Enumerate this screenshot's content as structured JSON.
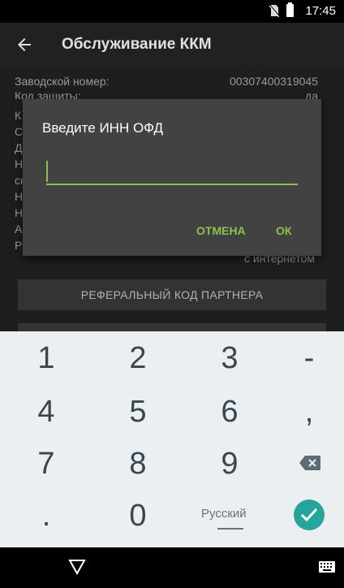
{
  "status_bar": {
    "time": "17:45"
  },
  "app_bar": {
    "title": "Обслуживание ККМ"
  },
  "background": {
    "rows": [
      {
        "label": "Заводской номер:",
        "value": "00307400319045"
      },
      {
        "label": "Код защиты:",
        "value": "да"
      }
    ],
    "side_letters": [
      "К",
      "С",
      "Д",
      "Н",
      "сн",
      "Н",
      "Н",
      "А",
      "Р"
    ],
    "internet_note": "с интернетом",
    "partner_button": "РЕФЕРАЛЬНЫЙ КОД ПАРТНЕРА"
  },
  "dialog": {
    "title": "Введите ИНН ОФД",
    "input_value": "",
    "cancel_label": "ОТМЕНА",
    "ok_label": "ОК"
  },
  "keyboard": {
    "rows": [
      [
        "1",
        "2",
        "3",
        "-"
      ],
      [
        "4",
        "5",
        "6",
        ","
      ],
      [
        "7",
        "8",
        "9"
      ],
      [
        ".",
        "0"
      ]
    ],
    "language": "Русский"
  },
  "colors": {
    "accent": "#8bc34a",
    "enter": "#26a69a",
    "dialog_bg": "#424242"
  }
}
